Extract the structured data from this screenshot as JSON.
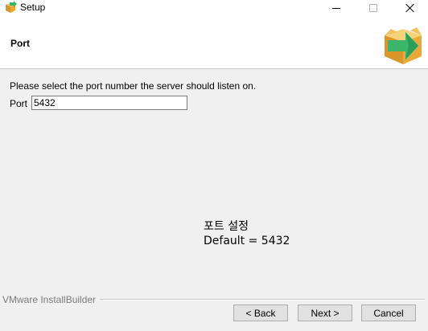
{
  "window": {
    "title": "Setup",
    "icon": "setup-box-icon",
    "controls": [
      "minimize-icon",
      "maximize-icon",
      "close-icon"
    ]
  },
  "header": {
    "title": "Port",
    "logo": "installer-box-arrow-icon"
  },
  "main": {
    "prompt": "Please select the port number the server should listen on.",
    "port_label": "Port",
    "port_value": "5432",
    "note_line1": "포트 설정",
    "note_line2": "Default = 5432"
  },
  "footer": {
    "brand": "VMware InstallBuilder",
    "back_label": "< Back",
    "next_label": "Next >",
    "cancel_label": "Cancel"
  },
  "colors": {
    "box": "#e8a93a",
    "arrow": "#3ab56a",
    "window_bg": "#f0f0f0"
  }
}
